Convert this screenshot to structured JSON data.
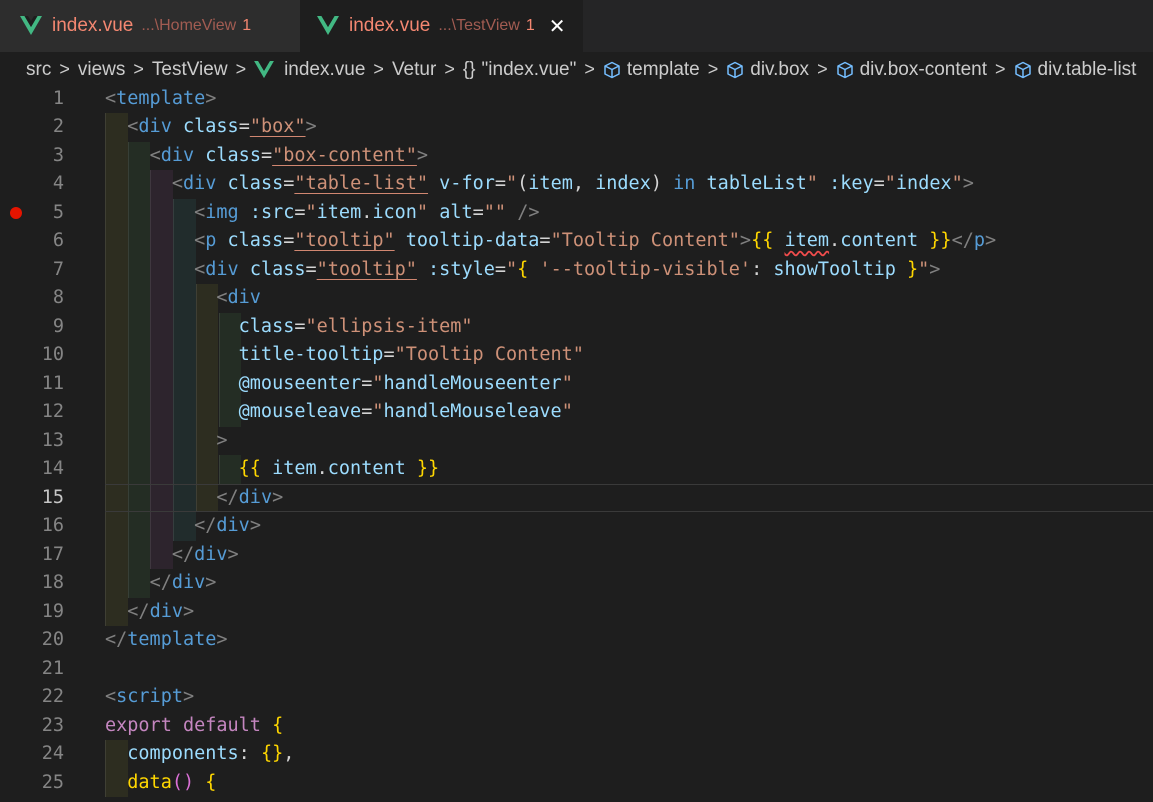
{
  "tabs": [
    {
      "name": "index.vue",
      "path": "...\\HomeView",
      "problems": "1"
    },
    {
      "name": "index.vue",
      "path": "...\\TestView",
      "problems": "1",
      "close": "✕"
    }
  ],
  "breadcrumb": {
    "items": [
      "src",
      "views",
      "TestView",
      "index.vue",
      "Vetur",
      "\"index.vue\"",
      "template",
      "div.box",
      "div.box-content",
      "div.table-list"
    ],
    "separator": ">",
    "braces": "{}"
  },
  "editor": {
    "active_line": 15,
    "breakpoint_line": 5,
    "line_numbers": [
      "1",
      "2",
      "3",
      "4",
      "5",
      "6",
      "7",
      "8",
      "9",
      "10",
      "11",
      "12",
      "13",
      "14",
      "15",
      "16",
      "17",
      "18",
      "19",
      "20",
      "21",
      "22",
      "23",
      "24",
      "25"
    ],
    "code_lines": [
      "<template>",
      "  <div class=\"box\">",
      "    <div class=\"box-content\">",
      "      <div class=\"table-list\" v-for=\"(item, index) in tableList\" :key=\"index\">",
      "        <img :src=\"item.icon\" alt=\"\" />",
      "        <p class=\"tooltip\" tooltip-data=\"Tooltip Content\">{{ item.content }}</p>",
      "        <div class=\"tooltip\" :style=\"{ '--tooltip-visible': showTooltip }\">",
      "          <div",
      "            class=\"ellipsis-item\"",
      "            title-tooltip=\"Tooltip Content\"",
      "            @mouseenter=\"handleMouseenter\"",
      "            @mouseleave=\"handleMouseleave\"",
      "          >",
      "            {{ item.content }}",
      "          </div>",
      "        </div>",
      "      </div>",
      "    </div>",
      "  </div>",
      "</template>",
      "",
      "<script>",
      "export default {",
      "  components: {},",
      "  data() {"
    ]
  },
  "colors": {
    "background": "#1e1e1e",
    "tab_error": "#f48771",
    "vue_green": "#42b883",
    "tag": "#569cd6",
    "attribute": "#9cdcfe",
    "string": "#ce9178",
    "bracket": "#ffd700",
    "breakpoint": "#e51400"
  }
}
